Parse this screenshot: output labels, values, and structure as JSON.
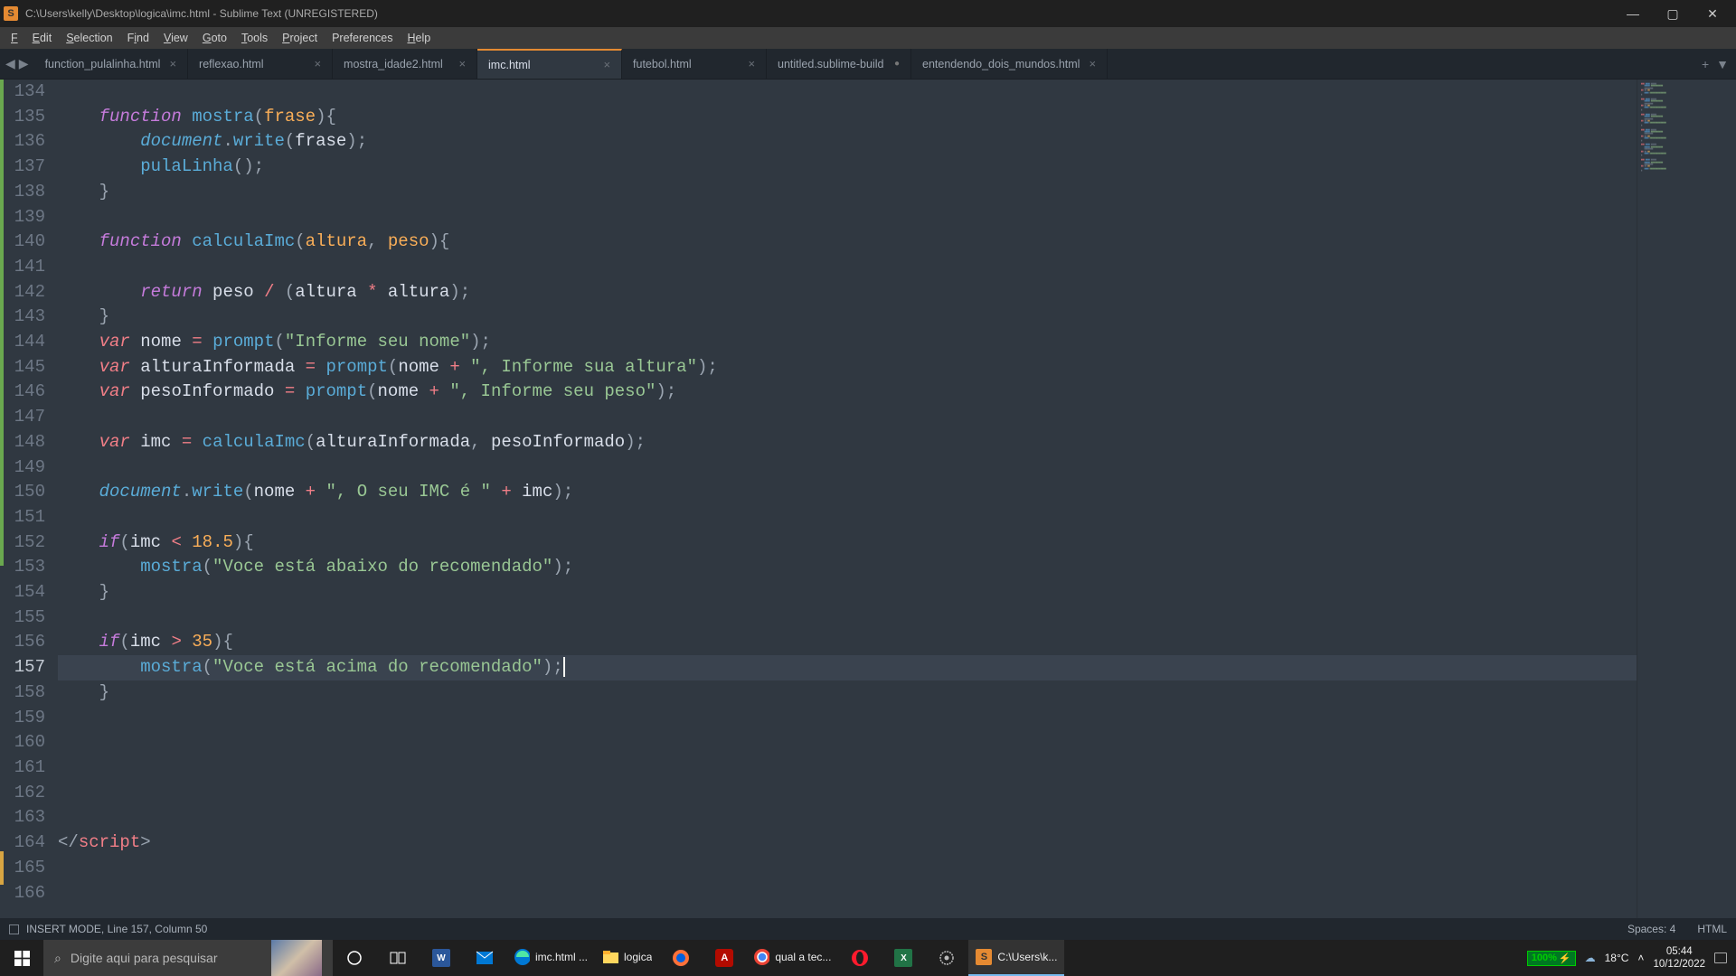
{
  "titlebar": {
    "title": "C:\\Users\\kelly\\Desktop\\logica\\imc.html - Sublime Text (UNREGISTERED)"
  },
  "menubar": {
    "items": [
      "File",
      "Edit",
      "Selection",
      "Find",
      "View",
      "Goto",
      "Tools",
      "Project",
      "Preferences",
      "Help"
    ]
  },
  "tabs": [
    {
      "label": "function_pulalinha.html",
      "active": false,
      "dirty": false
    },
    {
      "label": "reflexao.html",
      "active": false,
      "dirty": false
    },
    {
      "label": "mostra_idade2.html",
      "active": false,
      "dirty": false
    },
    {
      "label": "imc.html",
      "active": true,
      "dirty": false
    },
    {
      "label": "futebol.html",
      "active": false,
      "dirty": false
    },
    {
      "label": "untitled.sublime-build",
      "active": false,
      "dirty": true
    },
    {
      "label": "entendendo_dois_mundos.html",
      "active": false,
      "dirty": false
    }
  ],
  "first_line": 134,
  "active_line": 157,
  "gutter_mods": [
    {
      "top_pct": 0,
      "height_pct": 58,
      "class": ""
    },
    {
      "top_pct": 92,
      "height_pct": 4,
      "class": "orange"
    }
  ],
  "statusbar": {
    "left": "INSERT MODE, Line 157, Column 50",
    "right1": "Spaces: 4",
    "right2": "HTML"
  },
  "taskbar": {
    "search_placeholder": "Digite aqui para pesquisar",
    "items": [
      {
        "type": "icon",
        "name": "cortana"
      },
      {
        "type": "icon",
        "name": "task-view"
      },
      {
        "type": "icon",
        "name": "word"
      },
      {
        "type": "icon",
        "name": "mail"
      },
      {
        "type": "item",
        "name": "edge",
        "label": "imc.html ..."
      },
      {
        "type": "item",
        "name": "explorer",
        "label": "logica"
      },
      {
        "type": "icon",
        "name": "firefox"
      },
      {
        "type": "icon",
        "name": "acrobat"
      },
      {
        "type": "item",
        "name": "chrome",
        "label": "qual a tec..."
      },
      {
        "type": "icon",
        "name": "opera"
      },
      {
        "type": "icon",
        "name": "excel"
      },
      {
        "type": "icon",
        "name": "settings-gear"
      },
      {
        "type": "item",
        "name": "sublime",
        "label": "C:\\Users\\k...",
        "active": true
      }
    ],
    "battery": "100%",
    "temp": "18°C",
    "time": "05:44",
    "date": "10/12/2022"
  },
  "strings": {
    "informe_nome": "\"Informe seu nome\"",
    "informe_altura": "\", Informe sua altura\"",
    "informe_peso": "\", Informe seu peso\"",
    "seu_imc": "\", O seu IMC é \"",
    "abaixo": "\"Voce está abaixo do recomendado\"",
    "acima": "\"Voce está acima do recomendado\""
  },
  "nums": {
    "low": "18.5",
    "high": "35"
  },
  "tokens": {
    "function": "function",
    "var": "var",
    "return": "return",
    "if": "if",
    "document": "document",
    "write": "write",
    "prompt": "prompt",
    "script_close": "script"
  },
  "identifiers": {
    "mostra": "mostra",
    "frase": "frase",
    "pulaLinha": "pulaLinha",
    "calculaImc": "calculaImc",
    "altura": "altura",
    "peso": "peso",
    "nome": "nome",
    "alturaInformada": "alturaInformada",
    "pesoInformado": "pesoInformado",
    "imc": "imc"
  }
}
